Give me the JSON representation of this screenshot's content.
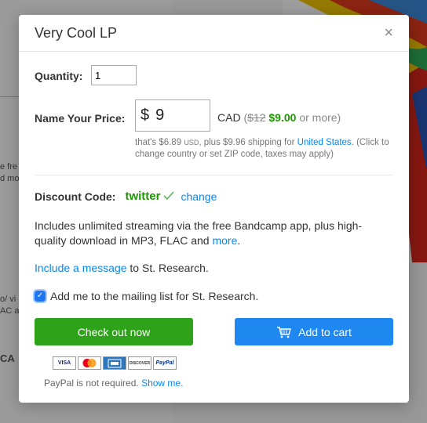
{
  "modal": {
    "title": "Very Cool LP",
    "close_label": "×"
  },
  "quantity": {
    "label": "Quantity:",
    "value": "1"
  },
  "price": {
    "label": "Name Your Price:",
    "currency_symbol": "$",
    "value": "9",
    "currency_code": "CAD",
    "paren_open": "(",
    "original_price": "$12",
    "sale_price": "$9.00",
    "or_more": "or more)",
    "note_prefix": "that's $6.89",
    "note_usd": "USD",
    "note_mid": ", plus $9.96 shipping for",
    "country_link": "United States",
    "note_suffix": ". (Click to change country or set ZIP code, taxes may apply)"
  },
  "discount": {
    "label": "Discount Code:",
    "code": "twitter",
    "check_icon": "check-icon",
    "change_link": "change"
  },
  "includes": {
    "text": "Includes unlimited streaming via the free Bandcamp app, plus high-quality download in MP3, FLAC and",
    "more_link": "more",
    "period": "."
  },
  "message": {
    "link": "Include a message",
    "suffix": "to St. Research."
  },
  "mailing": {
    "checked": true,
    "label": "Add me to the mailing list for St. Research."
  },
  "buttons": {
    "checkout": "Check out now",
    "cart": "Add to cart"
  },
  "cards": [
    "VISA",
    "MC",
    "AMEX",
    "DISCOVER",
    "PayPal"
  ],
  "paypal_note": {
    "text": "PayPal is not required.",
    "link": "Show me."
  },
  "background": {
    "fragment_1": "e fre",
    "fragment_2": "d mo",
    "fragment_3": "o/ vi",
    "fragment_4": "AC ar",
    "fragment_5": "CA"
  },
  "colors": {
    "green_button": "#2ea31a",
    "blue_button": "#1e87f0",
    "link": "#0687f5",
    "discount_green": "#1c9800"
  }
}
